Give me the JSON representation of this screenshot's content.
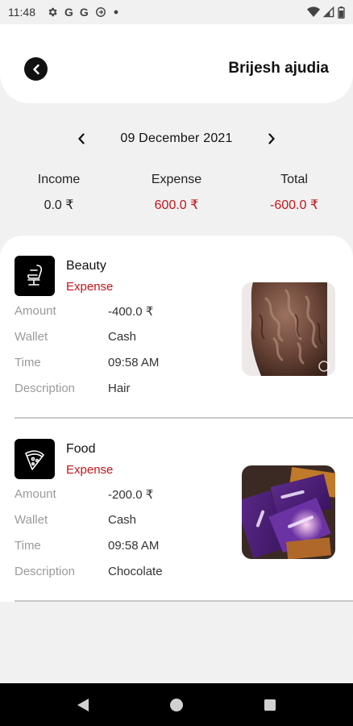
{
  "status_bar": {
    "time": "11:48",
    "left_icons": [
      "gear-icon",
      "google-icon",
      "google-icon",
      "sync-icon",
      "dot-icon"
    ],
    "right_icons": [
      "wifi-icon",
      "signal-icon",
      "battery-icon"
    ]
  },
  "header": {
    "title": "Brijesh ajudia",
    "back_icon": "back-arrow-icon"
  },
  "date_nav": {
    "date": "09 December 2021"
  },
  "summary": {
    "income_label": "Income",
    "income_value": "0.0 ₹",
    "expense_label": "Expense",
    "expense_value": "600.0 ₹",
    "total_label": "Total",
    "total_value": "-600.0 ₹"
  },
  "colors": {
    "expense_red": "#c2151b",
    "header_bg": "#ffffff",
    "page_bg": "#f1f1f1",
    "nav_bar": "#000000"
  },
  "transactions": [
    {
      "category": "Beauty",
      "category_icon": "salon-chair-icon",
      "type": "Expense",
      "amount_label": "Amount",
      "amount": "-400.0 ₹",
      "wallet_label": "Wallet",
      "wallet": "Cash",
      "time_label": "Time",
      "time": "09:58 AM",
      "description_label": "Description",
      "description": "Hair",
      "photo": "hair-photo"
    },
    {
      "category": "Food",
      "category_icon": "pizza-icon",
      "type": "Expense",
      "amount_label": "Amount",
      "amount": "-200.0 ₹",
      "wallet_label": "Wallet",
      "wallet": "Cash",
      "time_label": "Time",
      "time": "09:58 AM",
      "description_label": "Description",
      "description": "Chocolate",
      "photo": "chocolate-photo"
    }
  ],
  "nav_bar": {
    "buttons": [
      "back-triangle-icon",
      "home-circle-icon",
      "recents-square-icon"
    ]
  }
}
